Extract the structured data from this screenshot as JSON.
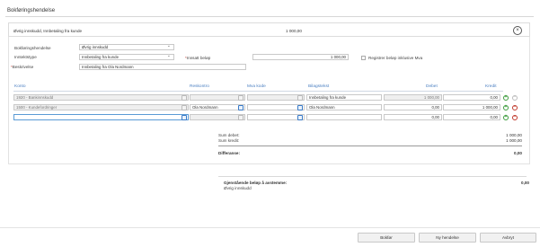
{
  "page": {
    "title": "Bokføringshendelse"
  },
  "summary": {
    "text": "Øvrig innskudd, Innbetaling fra kunde",
    "amount": "1 000,00"
  },
  "form": {
    "event_label": "Bokføringshendelse",
    "event_value": "Øvrig innskudd",
    "type_label": "Inntektstype",
    "type_value": "Innbetaling fra kunde",
    "amount_label": "Innsatt beløp",
    "amount_value": "1 000,00",
    "vat_checkbox_label": "Registrer beløp inklusive Mva",
    "description_label": "Beskrivelse",
    "description_value": "Innbetaling fra Ola Nordmann"
  },
  "table": {
    "headers": {
      "account": "Konto",
      "reskontro": "Reskontro",
      "vat_code": "Mva kode",
      "voucher_text": "Bilagstekst",
      "debit": "Debet",
      "credit": "Kredit"
    },
    "rows": [
      {
        "account": "1920 - Bankinnskudd",
        "reskontro": "",
        "vat_code": "",
        "voucher_text": "Innbetaling fra kunde",
        "debit": "1 000,00",
        "credit": "0,00"
      },
      {
        "account": "1500 - Kundefordringer",
        "reskontro": "Ola Nordmann",
        "vat_code": "",
        "voucher_text": "Ola Nordmann",
        "debit": "0,00",
        "credit": "1 000,00"
      },
      {
        "account": "",
        "reskontro": "",
        "vat_code": "",
        "voucher_text": "",
        "debit": "0,00",
        "credit": "0,00"
      }
    ]
  },
  "totals": {
    "debit_label": "Sum debet:",
    "debit_value": "1 000,00",
    "credit_label": "Sum kredit:",
    "credit_value": "1 000,00",
    "diff_label": "Differanse:",
    "diff_value": "0,00"
  },
  "remaining": {
    "label": "Gjenstående beløp å avstemme:",
    "value": "0,00",
    "sub": "Øvrig innskudd"
  },
  "buttons": {
    "post": "Bokfør",
    "new_event": "Ny hendelse",
    "cancel": "Avbryt"
  },
  "colors": {
    "accent": "#4a7fc1",
    "add": "#3c9b3c",
    "remove": "#c0392b"
  }
}
